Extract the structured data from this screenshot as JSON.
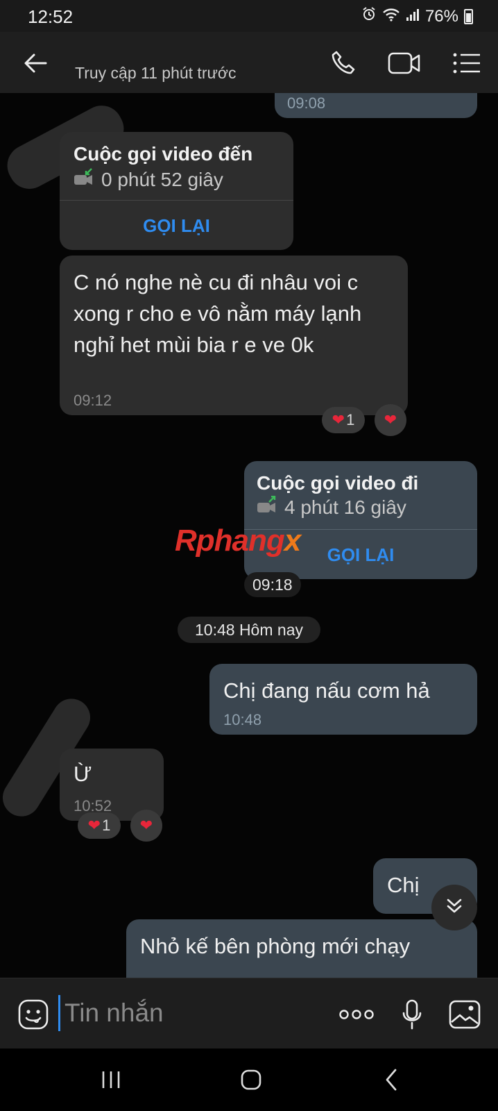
{
  "status_bar": {
    "time": "12:52",
    "battery": "76%"
  },
  "header": {
    "last_seen": "Truy cập 11 phút trước"
  },
  "messages": {
    "top_time": "09:08",
    "call_in": {
      "title": "Cuộc gọi video đến",
      "duration": "0 phút 52 giây",
      "action": "GỌI LẠI"
    },
    "msg1": {
      "text": "C nó nghe nè cu đi nhâu voi c xong r cho e vô nằm máy lạnh nghỉ het mùi bia r e ve 0k",
      "time": "09:12",
      "reaction_count": "1"
    },
    "call_out": {
      "title": "Cuộc gọi video đi",
      "duration": "4 phút 16 giây",
      "action": "GỌI LẠI",
      "time": "09:18"
    },
    "date_separator": "10:48 Hôm nay",
    "msg2": {
      "text": "Chị đang nấu cơm hả",
      "time": "10:48"
    },
    "msg3": {
      "text": "Ừ",
      "time": "10:52",
      "reaction_count": "1"
    },
    "msg4": {
      "text": "Chị"
    },
    "msg5": {
      "text": "Nhỏ kế bên phòng mới chạy"
    }
  },
  "watermark": {
    "part1": "Rphang",
    "part2": "x"
  },
  "composer": {
    "placeholder": "Tin nhắn"
  },
  "colors": {
    "accent": "#2f8cf0",
    "heart": "#e8263a",
    "outgoing_bubble": "#3b4650",
    "incoming_bubble": "#2d2d2d"
  }
}
